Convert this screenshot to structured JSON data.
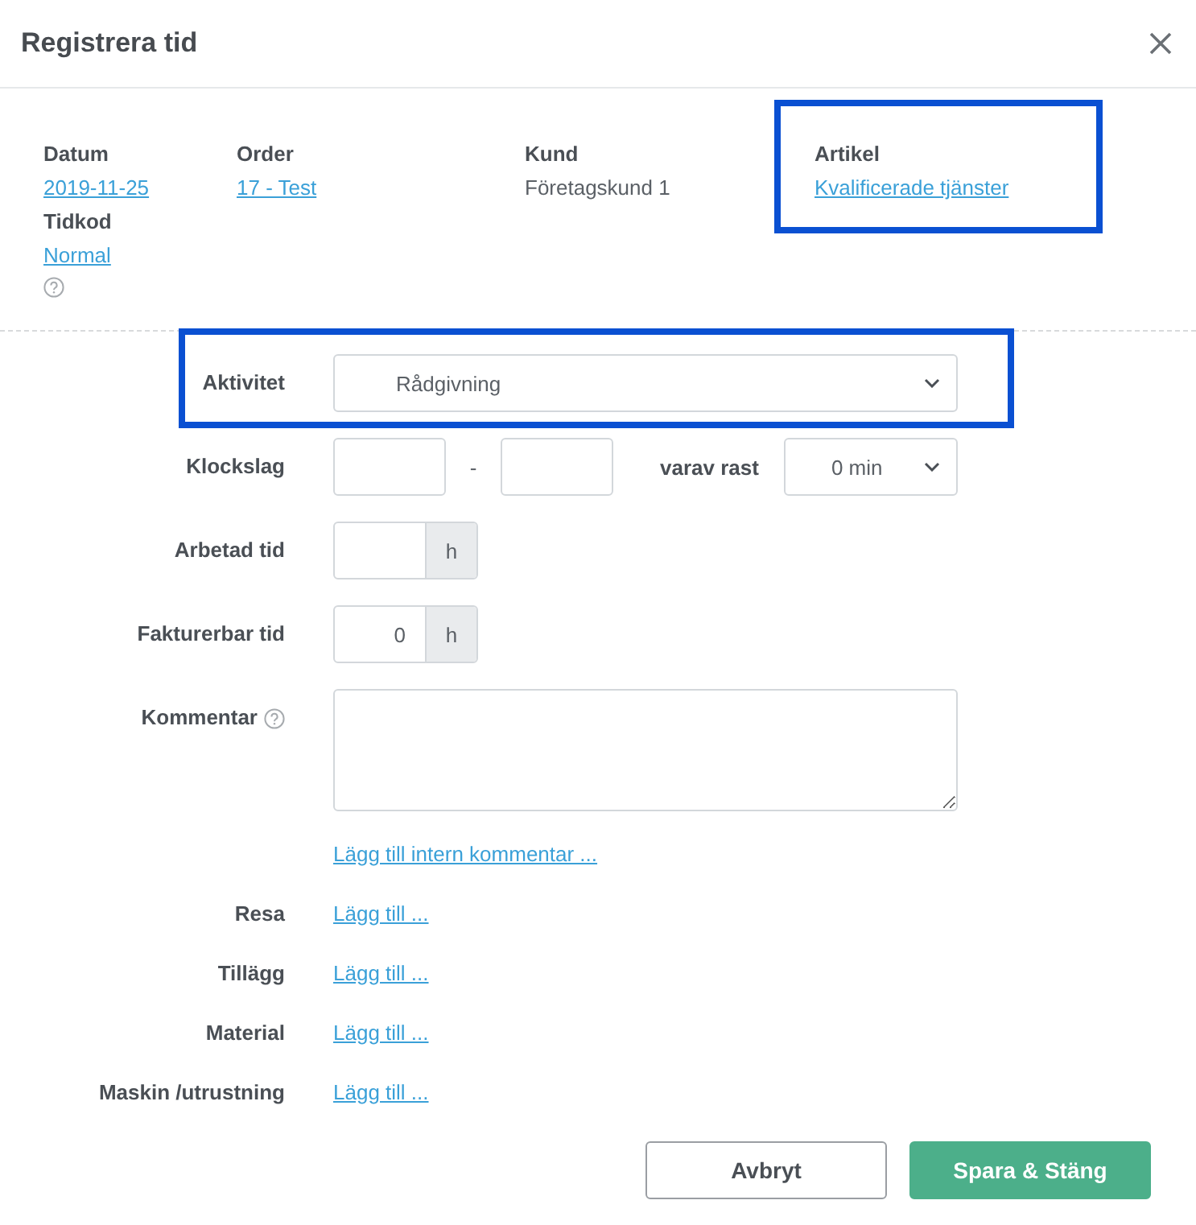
{
  "dialog": {
    "title": "Registrera tid"
  },
  "info_columns": [
    {
      "highlighted": false,
      "help": true,
      "items": [
        {
          "label": "Datum",
          "value": "2019-11-25",
          "kind": "link"
        },
        {
          "label": "Tidkod",
          "value": "Normal",
          "kind": "link"
        }
      ]
    },
    {
      "highlighted": false,
      "help": false,
      "items": [
        {
          "label": "Order",
          "value": "17 - Test",
          "kind": "link"
        }
      ]
    },
    {
      "highlighted": false,
      "help": false,
      "items": [
        {
          "label": "Kund",
          "value": "Företagskund 1",
          "kind": "text"
        }
      ]
    },
    {
      "highlighted": true,
      "help": false,
      "items": [
        {
          "label": "Artikel",
          "value": "Kvalificerade tjänster",
          "kind": "link"
        }
      ]
    }
  ],
  "form_rows": [
    {
      "kind": "select",
      "label": "Aktivitet",
      "value": "Rådgivning",
      "highlighted": true
    },
    {
      "kind": "time_range",
      "label": "Klockslag",
      "separator": "-",
      "break_label": "varav rast",
      "break_value": "0 min"
    },
    {
      "kind": "hours",
      "label": "Arbetad tid",
      "value": "",
      "unit": "h"
    },
    {
      "kind": "hours",
      "label": "Fakturerbar tid",
      "value": "0",
      "unit": "h"
    },
    {
      "kind": "textarea",
      "label": "Kommentar",
      "help": true
    },
    {
      "kind": "link",
      "label": "",
      "link": "Lägg till intern kommentar ..."
    },
    {
      "kind": "link",
      "label": "Resa",
      "link": "Lägg till ..."
    },
    {
      "kind": "link",
      "label": "Tillägg",
      "link": "Lägg till ..."
    },
    {
      "kind": "link",
      "label": "Material",
      "link": "Lägg till ..."
    },
    {
      "kind": "link",
      "label": "Maskin /utrustning",
      "link": "Lägg till ..."
    }
  ],
  "buttons": [
    {
      "label": "Avbryt",
      "kind": "secondary"
    },
    {
      "label": "Spara & Stäng",
      "kind": "primary"
    }
  ]
}
